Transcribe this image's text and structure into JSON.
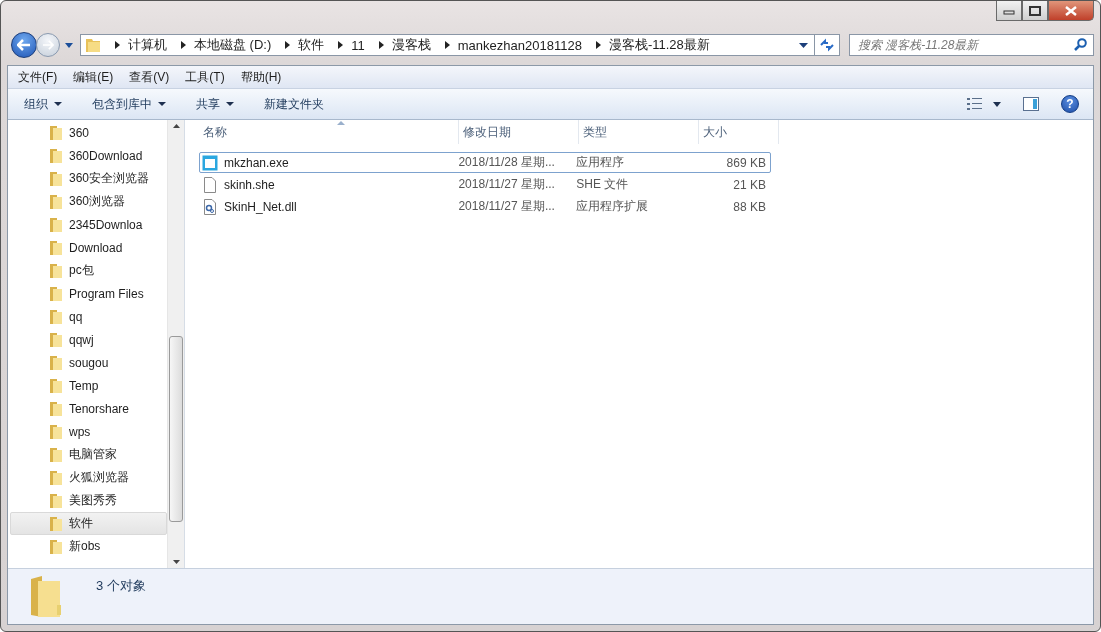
{
  "breadcrumb": [
    "计算机",
    "本地磁盘 (D:)",
    "软件",
    "11",
    "漫客栈",
    "mankezhan20181128",
    "漫客栈-11.28最新"
  ],
  "search": {
    "placeholder": "搜索 漫客栈-11.28最新"
  },
  "menu": [
    "文件(F)",
    "编辑(E)",
    "查看(V)",
    "工具(T)",
    "帮助(H)"
  ],
  "toolbar": [
    {
      "label": "组织",
      "dropdown": true
    },
    {
      "label": "包含到库中",
      "dropdown": true
    },
    {
      "label": "共享",
      "dropdown": true
    },
    {
      "label": "新建文件夹",
      "dropdown": false
    }
  ],
  "sidebar": {
    "items": [
      {
        "label": "360",
        "selected": false
      },
      {
        "label": "360Download",
        "selected": false
      },
      {
        "label": "360安全浏览器",
        "selected": false
      },
      {
        "label": "360浏览器",
        "selected": false
      },
      {
        "label": "2345Downloa",
        "selected": false
      },
      {
        "label": "Download",
        "selected": false
      },
      {
        "label": "pc包",
        "selected": false
      },
      {
        "label": "Program Files",
        "selected": false
      },
      {
        "label": "qq",
        "selected": false
      },
      {
        "label": "qqwj",
        "selected": false
      },
      {
        "label": "sougou",
        "selected": false
      },
      {
        "label": "Temp",
        "selected": false
      },
      {
        "label": "Tenorshare",
        "selected": false
      },
      {
        "label": "wps",
        "selected": false
      },
      {
        "label": "电脑管家",
        "selected": false
      },
      {
        "label": "火狐浏览器",
        "selected": false
      },
      {
        "label": "美图秀秀",
        "selected": false
      },
      {
        "label": "软件",
        "selected": true
      },
      {
        "label": "新obs",
        "selected": false
      }
    ]
  },
  "table": {
    "columns": [
      "名称",
      "修改日期",
      "类型",
      "大小"
    ],
    "rows": [
      {
        "kind": "exe",
        "name": "mkzhan.exe",
        "date": "2018/11/28 星期...",
        "type": "应用程序",
        "size": "869 KB",
        "selected": true
      },
      {
        "kind": "file",
        "name": "skinh.she",
        "date": "2018/11/27 星期...",
        "type": "SHE 文件",
        "size": "21 KB",
        "selected": false
      },
      {
        "kind": "dll",
        "name": "SkinH_Net.dll",
        "date": "2018/11/27 星期...",
        "type": "应用程序扩展",
        "size": "88 KB",
        "selected": false
      }
    ]
  },
  "help_button": {
    "glyph": "?"
  },
  "status_bar": {
    "text": "3 个对象"
  }
}
